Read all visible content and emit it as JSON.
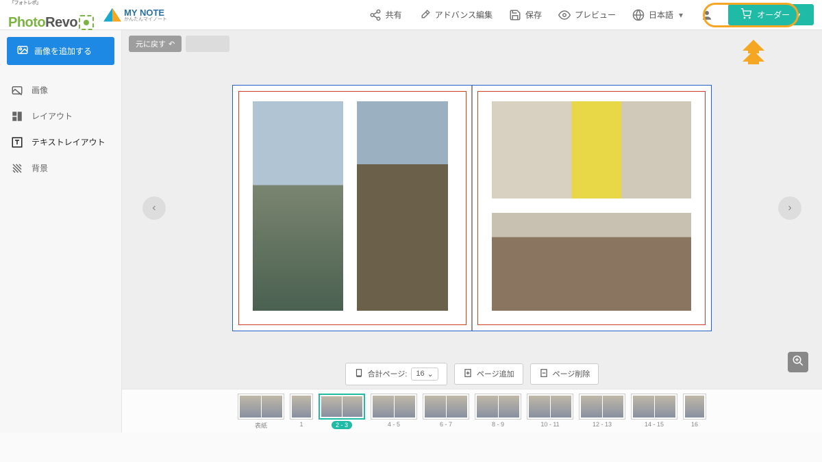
{
  "logo1": {
    "text_prefix": "Photo",
    "text_suffix": "Revo",
    "sub": "「フォトレボ」"
  },
  "logo2": {
    "line1": "MY NOTE",
    "line2": "かんたんマイノート"
  },
  "header": {
    "share": "共有",
    "advanced": "アドバンス編集",
    "save": "保存",
    "preview": "プレビュー",
    "language": "日本語",
    "order": "オーダー"
  },
  "sidebar": {
    "add_image": "画像を追加する",
    "items": [
      "画像",
      "レイアウト",
      "テキストレイアウト",
      "背景"
    ]
  },
  "toolbar": {
    "undo": "元に戻す",
    "redo": ""
  },
  "bottom": {
    "total_pages_label": "合計ページ:",
    "total_pages_value": "16",
    "add_page": "ページ追加",
    "delete_page": "ページ削除"
  },
  "thumbs": [
    {
      "label": "表紙",
      "single": false,
      "active": false
    },
    {
      "label": "1",
      "single": true,
      "active": false
    },
    {
      "label": "2 - 3",
      "single": false,
      "active": true
    },
    {
      "label": "4 - 5",
      "single": false,
      "active": false
    },
    {
      "label": "6 - 7",
      "single": false,
      "active": false
    },
    {
      "label": "8 - 9",
      "single": false,
      "active": false
    },
    {
      "label": "10 - 11",
      "single": false,
      "active": false
    },
    {
      "label": "12 - 13",
      "single": false,
      "active": false
    },
    {
      "label": "14 - 15",
      "single": false,
      "active": false
    },
    {
      "label": "16",
      "single": true,
      "active": false
    }
  ]
}
